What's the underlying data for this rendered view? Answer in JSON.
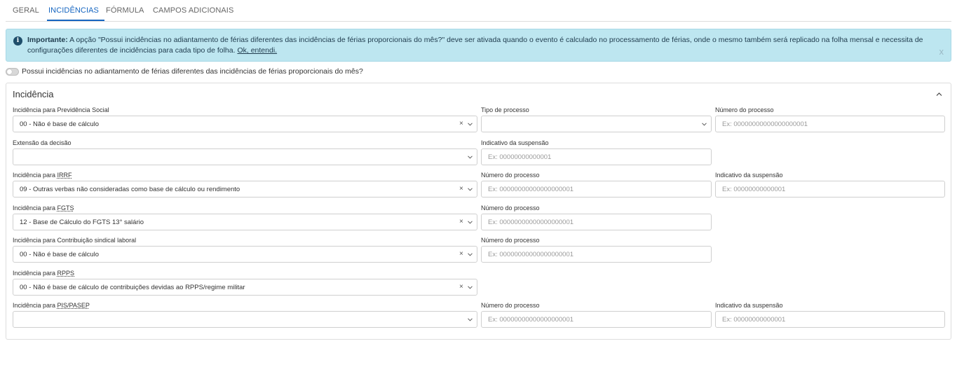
{
  "tabs": [
    "GERAL",
    "INCIDÊNCIAS",
    "FÓRMULA",
    "CAMPOS ADICIONAIS"
  ],
  "active_tab": "INCIDÊNCIAS",
  "alert": {
    "bold": "Importante:",
    "text": " A opção \"Possui incidências no adiantamento de férias diferentes das incidências de férias proporcionais do mês?\" deve ser ativada quando o evento é calculado no processamento de férias, onde o mesmo também será replicado na folha mensal e necessita de configurações diferentes de incidências para cada tipo de folha. ",
    "link": "Ok, entendi.",
    "close": "x"
  },
  "toggle": {
    "label": "Possui incidências no adiantamento de férias diferentes das incidências de férias proporcionais do mês?",
    "checked": false
  },
  "panel": {
    "title": "Incidência",
    "fields": {
      "prev_social": {
        "label": "Incidência para Previdência Social",
        "value": "00 - Não é base de cálculo"
      },
      "tipo_processo": {
        "label": "Tipo de processo",
        "value": ""
      },
      "num_proc_1": {
        "label": "Número do processo",
        "placeholder": "Ex: 00000000000000000001"
      },
      "extensao": {
        "label": "Extensão da decisão",
        "value": ""
      },
      "ind_susp_1": {
        "label": "Indicativo da suspensão",
        "placeholder": "Ex: 00000000000001"
      },
      "irrf": {
        "label_pre": "Incidência para ",
        "label_abbr": "IRRF",
        "value": "09 - Outras verbas não consideradas como base de cálculo ou rendimento"
      },
      "num_proc_2": {
        "label": "Número do processo",
        "placeholder": "Ex: 00000000000000000001"
      },
      "ind_susp_2": {
        "label": "Indicativo da suspensão",
        "placeholder": "Ex: 00000000000001"
      },
      "fgts": {
        "label_pre": "Incidência para ",
        "label_abbr": "FGTS",
        "value": "12 - Base de Cálculo do FGTS 13° salário"
      },
      "num_proc_3": {
        "label": "Número do processo",
        "placeholder": "Ex: 00000000000000000001"
      },
      "sindical": {
        "label": "Incidência para Contribuição sindical laboral",
        "value": "00 - Não é base de cálculo"
      },
      "num_proc_4": {
        "label": "Número do processo",
        "placeholder": "Ex: 00000000000000000001"
      },
      "rpps": {
        "label_pre": "Incidência para ",
        "label_abbr": "RPPS",
        "value": "00 - Não é base de cálculo de contribuições devidas ao RPPS/regime militar"
      },
      "pis": {
        "label_pre": "Incidência para ",
        "label_abbr": "PIS/PASEP",
        "value": ""
      },
      "num_proc_5": {
        "label": "Número do processo",
        "placeholder": "Ex: 00000000000000000001"
      },
      "ind_susp_3": {
        "label": "Indicativo da suspensão",
        "placeholder": "Ex: 00000000000001"
      }
    }
  },
  "icons": {
    "info": "info-circle-icon",
    "clear": "clear-x-icon",
    "dropdown": "chevron-down-icon",
    "collapse": "chevron-up-icon"
  },
  "colors": {
    "accent": "#1565c0",
    "alert_bg": "#bde6f0",
    "alert_text": "#1f3b4d"
  }
}
